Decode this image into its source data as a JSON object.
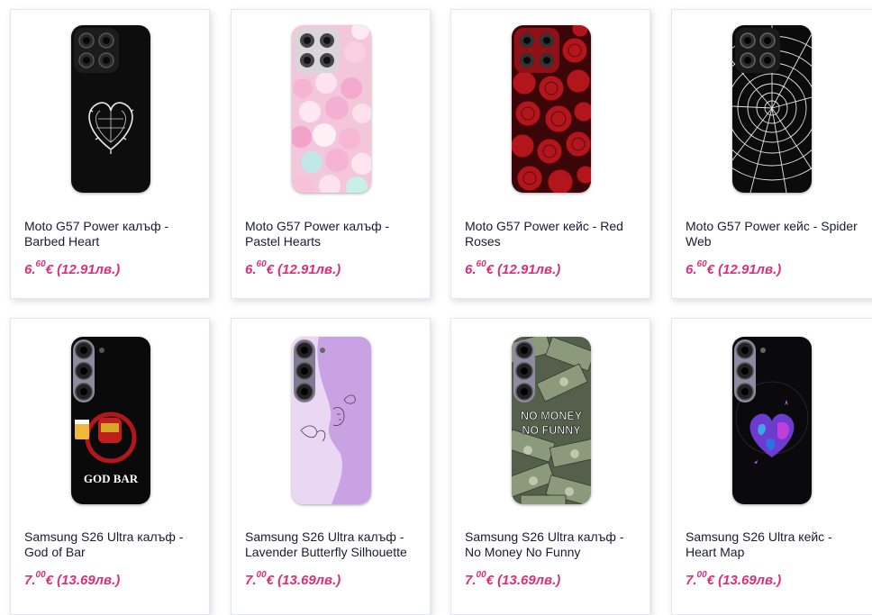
{
  "accent_price_color": "#d9307a",
  "products": [
    {
      "name": "Moto G57 Power калъф - Barbed Heart",
      "price_main": "6.",
      "price_cents": "60",
      "price_rest": "€ (12.91лв.)",
      "design": "barbed-heart"
    },
    {
      "name": "Moto G57 Power калъф - Pastel Hearts",
      "price_main": "6.",
      "price_cents": "60",
      "price_rest": "€ (12.91лв.)",
      "design": "pastel-hearts"
    },
    {
      "name": "Moto G57 Power кейс - Red Roses",
      "price_main": "6.",
      "price_cents": "60",
      "price_rest": "€ (12.91лв.)",
      "design": "red-roses"
    },
    {
      "name": "Moto G57 Power кейс - Spider Web",
      "price_main": "6.",
      "price_cents": "60",
      "price_rest": "€ (12.91лв.)",
      "design": "spider-web"
    },
    {
      "name": "Samsung S26 Ultra калъф - God of Bar",
      "price_main": "7.",
      "price_cents": "00",
      "price_rest": "€ (13.69лв.)",
      "design": "god-of-bar",
      "art_text": "GOD BAR"
    },
    {
      "name": "Samsung S26 Ultra калъф - Lavender Butterfly Silhouette",
      "price_main": "7.",
      "price_cents": "00",
      "price_rest": "€ (13.69лв.)",
      "design": "lavender-butterfly"
    },
    {
      "name": "Samsung S26 Ultra калъф - No Money No Funny",
      "price_main": "7.",
      "price_cents": "00",
      "price_rest": "€ (13.69лв.)",
      "design": "no-money",
      "art_text_1": "NO MONEY",
      "art_text_2": "NO FUNNY"
    },
    {
      "name": "Samsung S26 Ultra кейс - Heart Map",
      "price_main": "7.",
      "price_cents": "00",
      "price_rest": "€ (13.69лв.)",
      "design": "heart-map"
    }
  ]
}
